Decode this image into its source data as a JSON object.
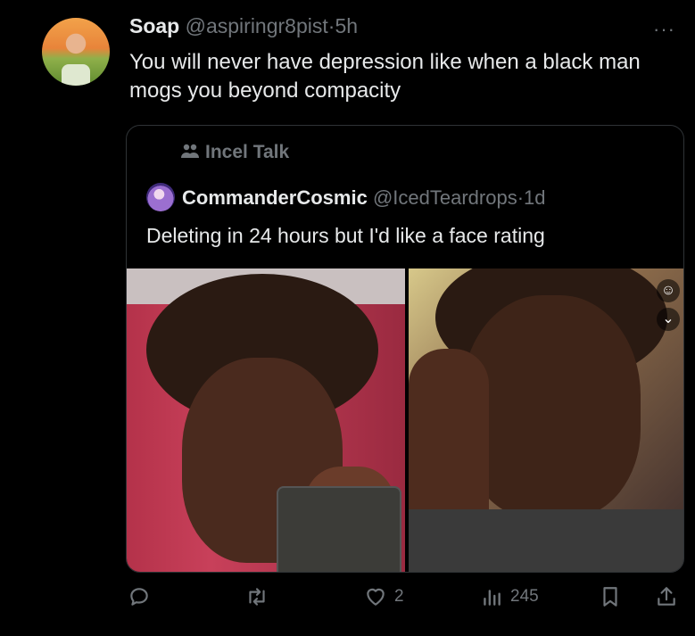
{
  "tweet": {
    "display_name": "Soap",
    "handle": "@aspiringr8pist",
    "separator": "·",
    "time": "5h",
    "more": "···",
    "text": "You will never have depression like when a black man mogs you beyond compacity"
  },
  "quote": {
    "community": "Incel Talk",
    "display_name": "CommanderCosmic",
    "handle": "@IcedTeardrops",
    "separator": "·",
    "time": "1d",
    "text": "Deleting in 24 hours but I'd like a face rating"
  },
  "actions": {
    "reply_count": "",
    "retweet_count": "",
    "like_count": "2",
    "views_count": "245"
  },
  "icons": {
    "reply": "reply-icon",
    "retweet": "retweet-icon",
    "like": "heart-icon",
    "views": "views-icon",
    "bookmark": "bookmark-icon",
    "share": "share-icon",
    "community": "community-icon"
  },
  "colors": {
    "background": "#000000",
    "text": "#e7e9ea",
    "secondary": "#71767b",
    "border": "#2f3336"
  }
}
